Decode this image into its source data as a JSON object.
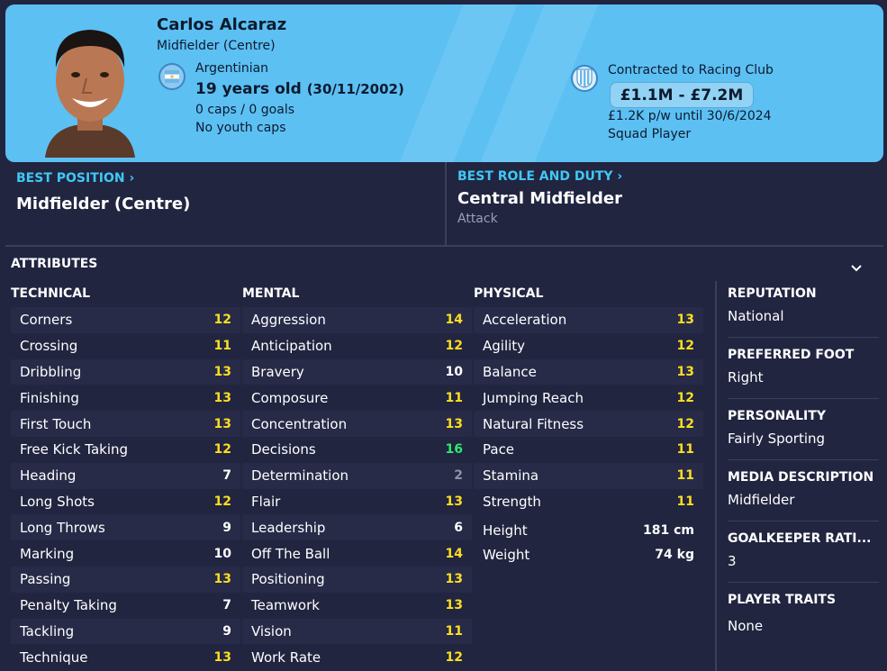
{
  "player": {
    "name": "Carlos Alcaraz",
    "position": "Midfielder (Centre)",
    "nationality": "Argentinian",
    "age": "19 years old",
    "dob": "(30/11/2002)",
    "caps": "0 caps / 0 goals",
    "youth_caps": "No youth caps"
  },
  "contract": {
    "club": "Contracted to Racing Club",
    "value": "£1.1M - £7.2M",
    "wage": "£1.2K p/w until 30/6/2024",
    "status": "Squad Player"
  },
  "best_position": {
    "label": "BEST POSITION",
    "value": "Midfielder (Centre)"
  },
  "best_role": {
    "label": "BEST ROLE AND DUTY",
    "value": "Central Midfielder",
    "duty": "Attack"
  },
  "attributes_title": "ATTRIBUTES",
  "technical": {
    "title": "TECHNICAL",
    "items": [
      {
        "name": "Corners",
        "value": "12",
        "color": "yellow"
      },
      {
        "name": "Crossing",
        "value": "11",
        "color": "yellow"
      },
      {
        "name": "Dribbling",
        "value": "13",
        "color": "yellow"
      },
      {
        "name": "Finishing",
        "value": "13",
        "color": "yellow"
      },
      {
        "name": "First Touch",
        "value": "13",
        "color": "yellow"
      },
      {
        "name": "Free Kick Taking",
        "value": "12",
        "color": "yellow"
      },
      {
        "name": "Heading",
        "value": "7",
        "color": "white"
      },
      {
        "name": "Long Shots",
        "value": "12",
        "color": "yellow"
      },
      {
        "name": "Long Throws",
        "value": "9",
        "color": "white"
      },
      {
        "name": "Marking",
        "value": "10",
        "color": "white"
      },
      {
        "name": "Passing",
        "value": "13",
        "color": "yellow"
      },
      {
        "name": "Penalty Taking",
        "value": "7",
        "color": "white"
      },
      {
        "name": "Tackling",
        "value": "9",
        "color": "white"
      },
      {
        "name": "Technique",
        "value": "13",
        "color": "yellow"
      }
    ]
  },
  "mental": {
    "title": "MENTAL",
    "items": [
      {
        "name": "Aggression",
        "value": "14",
        "color": "yellow"
      },
      {
        "name": "Anticipation",
        "value": "12",
        "color": "yellow"
      },
      {
        "name": "Bravery",
        "value": "10",
        "color": "white"
      },
      {
        "name": "Composure",
        "value": "11",
        "color": "yellow"
      },
      {
        "name": "Concentration",
        "value": "13",
        "color": "yellow"
      },
      {
        "name": "Decisions",
        "value": "16",
        "color": "green"
      },
      {
        "name": "Determination",
        "value": "2",
        "color": "grey"
      },
      {
        "name": "Flair",
        "value": "13",
        "color": "yellow"
      },
      {
        "name": "Leadership",
        "value": "6",
        "color": "white"
      },
      {
        "name": "Off The Ball",
        "value": "14",
        "color": "yellow"
      },
      {
        "name": "Positioning",
        "value": "13",
        "color": "yellow"
      },
      {
        "name": "Teamwork",
        "value": "13",
        "color": "yellow"
      },
      {
        "name": "Vision",
        "value": "11",
        "color": "yellow"
      },
      {
        "name": "Work Rate",
        "value": "12",
        "color": "yellow"
      }
    ]
  },
  "physical": {
    "title": "PHYSICAL",
    "items": [
      {
        "name": "Acceleration",
        "value": "13",
        "color": "yellow"
      },
      {
        "name": "Agility",
        "value": "12",
        "color": "yellow"
      },
      {
        "name": "Balance",
        "value": "13",
        "color": "yellow"
      },
      {
        "name": "Jumping Reach",
        "value": "12",
        "color": "yellow"
      },
      {
        "name": "Natural Fitness",
        "value": "12",
        "color": "yellow"
      },
      {
        "name": "Pace",
        "value": "11",
        "color": "yellow"
      },
      {
        "name": "Stamina",
        "value": "11",
        "color": "yellow"
      },
      {
        "name": "Strength",
        "value": "11",
        "color": "yellow"
      }
    ],
    "height_label": "Height",
    "height": "181 cm",
    "weight_label": "Weight",
    "weight": "74 kg"
  },
  "info": {
    "reputation_label": "REPUTATION",
    "reputation": "National",
    "foot_label": "PREFERRED FOOT",
    "foot": "Right",
    "personality_label": "PERSONALITY",
    "personality": "Fairly Sporting",
    "media_label": "MEDIA DESCRIPTION",
    "media": "Midfielder",
    "gk_label": "GOALKEEPER RATI...",
    "gk": "3",
    "traits_label": "PLAYER TRAITS",
    "traits": "None"
  },
  "colors": {
    "header_bg": "#5cc0f3",
    "page_bg": "#212540",
    "accent": "#3fc8f5",
    "attr_yellow": "#ffde21",
    "attr_green": "#2ee86e",
    "attr_grey": "#8d92a6"
  }
}
